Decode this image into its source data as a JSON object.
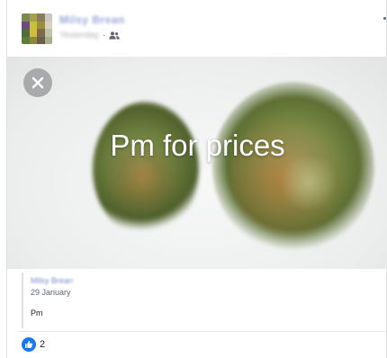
{
  "post": {
    "author": "Milsy Brean",
    "time": "Yesterday",
    "separator": "·",
    "privacy_icon": "friends-icon",
    "image_overlay_text": "Pm for prices",
    "close_icon": "close-icon"
  },
  "quote": {
    "author": "Milsy Brean",
    "date": "29 January",
    "text": "Pm"
  },
  "reactions": {
    "icon": "like-icon",
    "count": "2"
  },
  "colors": {
    "like_blue": "#1877f2",
    "link_blue": "#7d8fcc"
  }
}
